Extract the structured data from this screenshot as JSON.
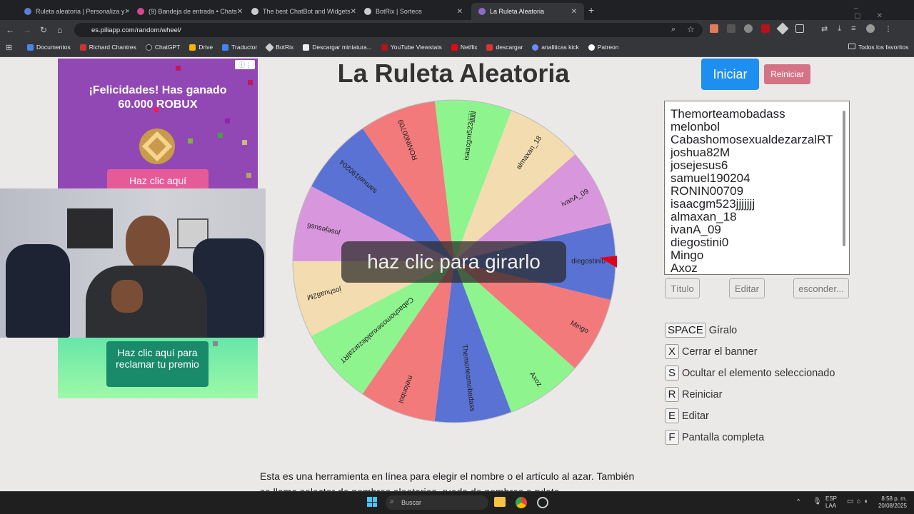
{
  "browser": {
    "tabs": [
      {
        "title": "Ruleta aleatoria | Personaliza y",
        "color": "#5b7fd6"
      },
      {
        "title": "(9) Bandeja de entrada • Chats",
        "color": "#d6478f"
      },
      {
        "title": "The best ChatBot and Widgets",
        "color": "#cccccc"
      },
      {
        "title": "BotRix | Sorteos",
        "color": "#cccccc"
      },
      {
        "title": "La Ruleta Aleatoria",
        "color": "#8b6cc7"
      }
    ],
    "url": "es.piliapp.com/random/wheel/",
    "bookmarks": [
      "Documentos",
      "Richard Chantres",
      "ChatGPT",
      "Drive",
      "Traductor",
      "BotRix",
      "Descargar miniatura...",
      "YouTube Viewstats",
      "Netflix",
      "descargar",
      "analiticas kick",
      "Patreon"
    ],
    "all_bookmarks": "Todos los favoritos"
  },
  "ad": {
    "headline": "¡Felicidades! Has ganado",
    "amount": "60.000 ROBUX",
    "button_top": "Haz clic aquí",
    "button_bottom": "Haz clic aquí para reclamar tu premio"
  },
  "page": {
    "title": "La Ruleta Aleatoria",
    "start_label": "Iniciar",
    "reset_label": "Reiniciar",
    "spin_prompt": "haz clic para girarlo",
    "title_button": "Título",
    "edit_button": "Editar",
    "hide_button": "esconder...",
    "description": "Esta es una herramienta en línea para elegir el nombre o el artículo al azar. También se llama selector de nombres aleatorios, rueda de nombres o ruleta."
  },
  "names": [
    "Themorteamobadass",
    "melonbol",
    "CabashomosexualdezarzalRT",
    "joshua82M",
    "josejesus6",
    "samuel190204",
    "RONIN00709",
    "isaacgm523jjjjjjj",
    "almaxan_18",
    "ivanA_09",
    "diegostini0",
    "Mingo",
    "Axoz"
  ],
  "shortcuts": [
    {
      "key": "SPACE",
      "label": "Gíralo"
    },
    {
      "key": "X",
      "label": "Cerrar el banner"
    },
    {
      "key": "S",
      "label": "Ocultar el elemento seleccionado"
    },
    {
      "key": "R",
      "label": "Reiniciar"
    },
    {
      "key": "E",
      "label": "Editar"
    },
    {
      "key": "F",
      "label": "Pantalla completa"
    }
  ],
  "taskbar": {
    "search_placeholder": "Buscar",
    "lang_top": "ESP",
    "lang_bottom": "LAA",
    "time": "8:58 p. m.",
    "date": "20/08/2025"
  },
  "colors": {
    "start": "#1e8ef0",
    "reset": "#d57386",
    "pointer": "#e0001b",
    "segments": [
      "#5a72d4",
      "#f37a7b",
      "#8ef58e",
      "#f3ddb0",
      "#d897dc"
    ]
  }
}
